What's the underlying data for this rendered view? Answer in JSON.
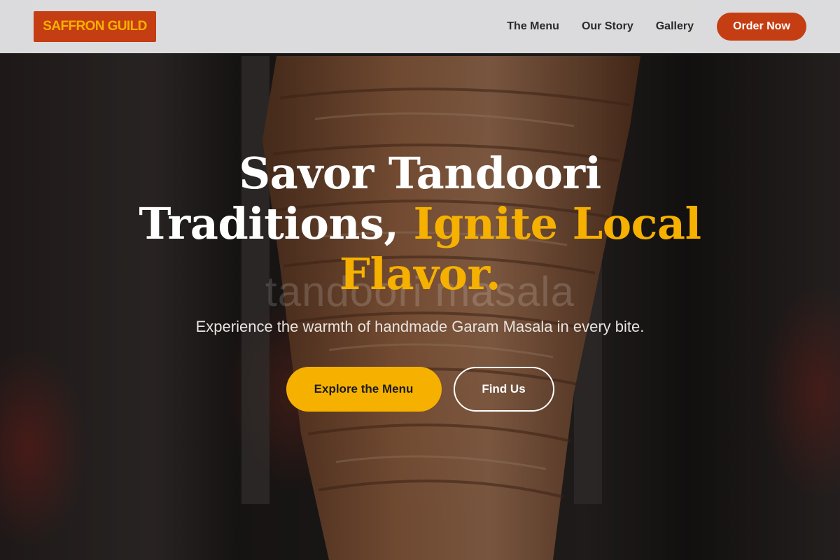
{
  "header": {
    "logo_text": "SAFFRON GUILD",
    "nav": [
      {
        "label": "The Menu"
      },
      {
        "label": "Our Story"
      },
      {
        "label": "Gallery"
      }
    ],
    "cta_label": "Order Now"
  },
  "hero": {
    "title_line_1": "Savor Tandoori",
    "title_line_2_white": "Traditions, ",
    "title_line_2_accent": "Ignite Local",
    "title_line_3_accent": "Flavor.",
    "ghost_text": "tandoori masala",
    "subtitle": "Experience the warmth of handmade Garam Masala in every bite.",
    "primary_button": "Explore the Menu",
    "secondary_button": "Find Us",
    "background_image": "tandoori-meat-skewer-photo"
  },
  "colors": {
    "brand_red": "#c53d12",
    "accent_yellow": "#f6b100",
    "header_bg": "#e8e8ea",
    "nav_text": "#2a2a2a"
  }
}
